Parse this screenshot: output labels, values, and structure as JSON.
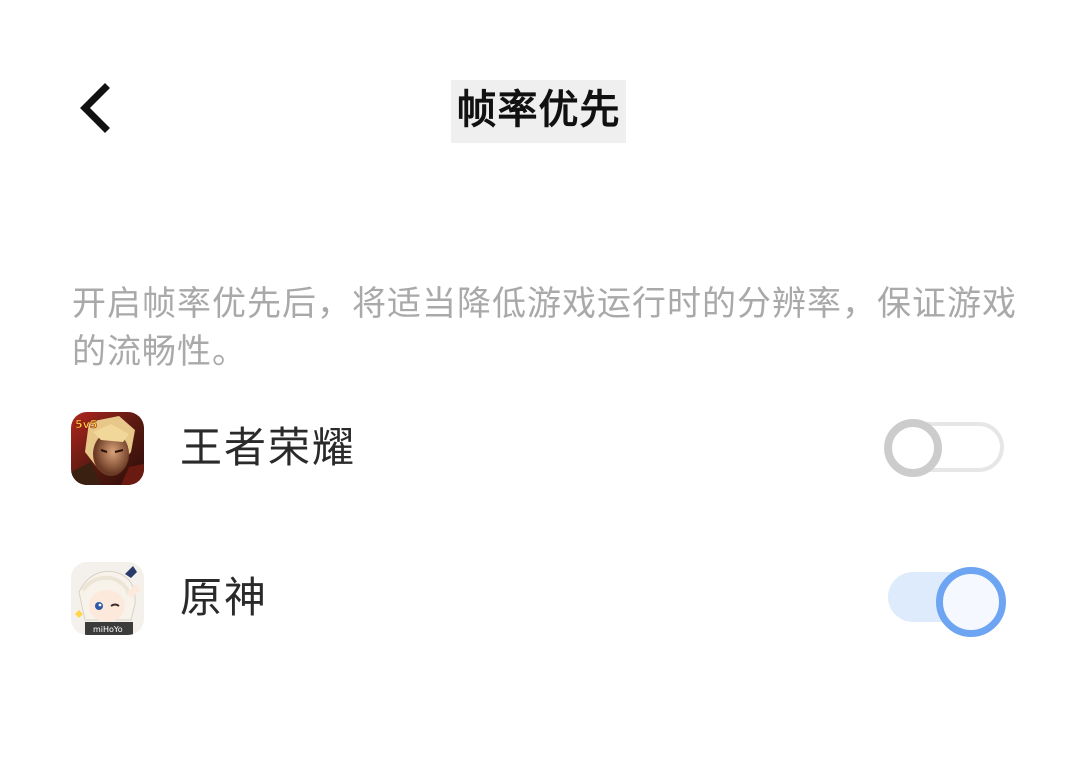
{
  "header": {
    "title": "帧率优先",
    "back_icon": "chevron-left-icon"
  },
  "description": "开启帧率优先后，将适当降低游戏运行时的分辨率，保证游戏的流畅性。",
  "apps": [
    {
      "name": "王者荣耀",
      "icon": "wangzhe-app-icon",
      "badge": "5v5",
      "enabled": false
    },
    {
      "name": "原神",
      "icon": "genshin-app-icon",
      "badge": "miHoYo",
      "enabled": true
    }
  ],
  "colors": {
    "toggle_on_track": "#deebfc",
    "toggle_on_knob_border": "#6ea5f2",
    "toggle_off_knob_border": "#cccccc",
    "toggle_off_track_border": "#e6e6e6",
    "description_text": "#a9a9a9",
    "title_bg": "#efefef"
  }
}
